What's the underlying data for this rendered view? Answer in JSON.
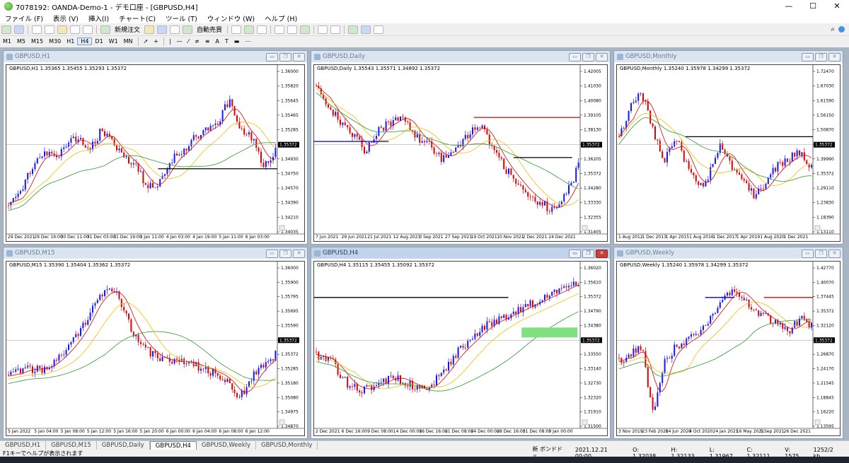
{
  "window": {
    "title": "7078192: OANDA-Demo-1 - デモ口座 - [GBPUSD,H4]",
    "min": "—",
    "max": "☐",
    "close": "✕"
  },
  "menu": [
    "ファイル (F)",
    "表示 (V)",
    "挿入(I)",
    "チャート(C)",
    "ツール (T)",
    "ウィンドウ (W)",
    "ヘルプ (H)"
  ],
  "toolbar": {
    "new_order": "新規注文",
    "auto_trade": "自動売買"
  },
  "timeframes": [
    "M1",
    "M5",
    "M15",
    "M30",
    "H1",
    "H4",
    "D1",
    "W1",
    "MN"
  ],
  "active_timeframe": "H4",
  "charts": [
    {
      "id": "h1",
      "title": "GBPUSD,H1",
      "header": "GBPUSD,H1  1.35365 1.35455 1.35293 1.35372",
      "price_labels": [
        "1.36000",
        "1.35820",
        "1.35645",
        "1.35465",
        "1.35285",
        "1.35105",
        "1.34930",
        "1.34750",
        "1.34570",
        "1.34390",
        "1.34210",
        "1.34035"
      ],
      "current": "1.35372",
      "time_labels": [
        "29 Dec 2021",
        "29 Dec 19:00",
        "30 Dec 11:00",
        "31 Dec 03:00",
        "31 Dec 19:00",
        "3 Jan 11:00",
        "4 Jan 03:00",
        "4 Jan 19:00",
        "5 Jan 11:00",
        "6 Jan 03:00"
      ]
    },
    {
      "id": "daily",
      "title": "GBPUSD,Daily",
      "header": "GBPUSD,Daily  1.35543 1.35571 1.34892 1.35372",
      "price_labels": [
        "1.42005",
        "1.41030",
        "1.40080",
        "1.39105",
        "1.38130",
        "1.37180",
        "1.36205",
        "1.35372",
        "1.34280",
        "1.33330",
        "1.32355",
        "1.31405"
      ],
      "current": "1.35372",
      "time_labels": [
        "7 Jun 2021",
        "29 Jun 2021",
        "21 Jul 2021",
        "12 Aug 2021",
        "3 Sep 2021",
        "27 Sep 2021",
        "19 Oct 2021",
        "10 Nov 2021",
        "2 Dec 2021",
        "24 Dec 2021"
      ]
    },
    {
      "id": "monthly",
      "title": "GBPUSD,Monthly",
      "header": "GBPUSD,Monthly  1.35240 1.35978 1.34299 1.35372",
      "price_labels": [
        "1.72470",
        "1.67030",
        "1.61590",
        "1.56150",
        "1.50870",
        "1.45430",
        "1.39990",
        "1.35372",
        "1.29110",
        "1.23830",
        "1.18390",
        "1.13110"
      ],
      "current": "1.35372",
      "time_labels": [
        "1 Aug 2012",
        "1 Dec 2013",
        "1 Apr 2015",
        "1 Aug 2016",
        "1 Dec 2017",
        "1 Apr 2019",
        "1 Aug 2020",
        "1 Dec 2021"
      ]
    },
    {
      "id": "m15",
      "title": "GBPUSD,M15",
      "header": "GBPUSD,M15  1.35390 1.35404 1.35362 1.35372",
      "price_labels": [
        "1.36000",
        "1.35900",
        "1.35795",
        "1.35695",
        "1.35590",
        "1.35490",
        "1.35372",
        "1.35285",
        "1.35180",
        "1.35080",
        "1.34975",
        "1.34870"
      ],
      "current": "1.35372",
      "time_labels": [
        "5 Jan 2022",
        "5 Jan 04:00",
        "5 Jan 08:00",
        "5 Jan 12:00",
        "5 Jan 16:00",
        "5 Jan 20:00",
        "6 Jan 00:00",
        "6 Jan 04:00",
        "6 Jan 08:00",
        "6 Jan 12:00"
      ]
    },
    {
      "id": "h4",
      "title": "GBPUSD,H4",
      "header": "GBPUSD,H4  1.35115 1.35455 1.35092 1.35372",
      "price_labels": [
        "1.36020",
        "1.35610",
        "1.35372",
        "1.34790",
        "1.34380",
        "1.33960",
        "1.33550",
        "1.33140",
        "1.32730",
        "1.32320",
        "1.31910",
        "1.31500"
      ],
      "current": "1.35372",
      "time_labels": [
        "2 Dec 2021",
        "6 Dec 16:00",
        "9 Dec 08:00",
        "14 Dec 00:00",
        "16 Dec 16:00",
        "21 Dec 08:00",
        "24 Dec 00:00",
        "28 Dec 16:00",
        "31 Dec 08:00",
        "5 Jan 00:00"
      ]
    },
    {
      "id": "weekly",
      "title": "GBPUSD,Weekly",
      "header": "GBPUSD,Weekly  1.35240 1.35978 1.34299 1.35372",
      "price_labels": [
        "1.42770",
        "1.40070",
        "1.37445",
        "1.35372",
        "1.32120",
        "1.29450",
        "1.26870",
        "1.24170",
        "1.21545",
        "1.18845",
        "1.16220",
        "1.13595"
      ],
      "current": "1.35372",
      "time_labels": [
        "3 Nov 2019",
        "23 Feb 2020",
        "14 Jun 2020",
        "4 Oct 2020",
        "24 Jan 2021",
        "16 May 2021",
        "5 Sep 2021",
        "26 Dec 2021"
      ]
    }
  ],
  "tabs": [
    "GBPUSD,H1",
    "GBPUSD,M15",
    "GBPUSD,Daily",
    "GBPUSD,H4",
    "GBPUSD,Weekly",
    "GBPUSD,Monthly"
  ],
  "active_tab": "GBPUSD,H4",
  "status": {
    "help": "F1キーでヘルプが表示されます",
    "profile": "新 ボンドドル",
    "datetime": "2021.12.21 00:00",
    "open": "O: 1.32038",
    "high": "H: 1.32133",
    "low": "L: 1.31967",
    "close": "C: 1.32111",
    "volume": "V: 1575",
    "traffic": "1252/2 kb"
  },
  "colors": {
    "bull": "#1414ff",
    "bear": "#e00000",
    "ma_fast": "#e00000",
    "ma_mid": "#f0c000",
    "ma_slow": "#2e9a2e",
    "zone": "#7fe07f"
  }
}
